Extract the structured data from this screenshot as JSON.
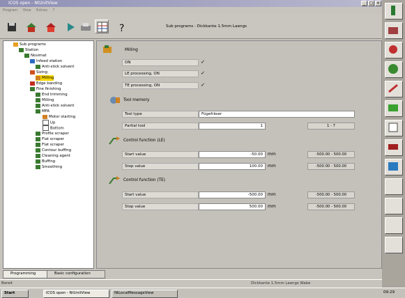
{
  "window": {
    "title": "ICOS open - NtUnitView"
  },
  "menu": [
    "Program",
    "View",
    "Extras",
    "?"
  ],
  "toolbar": {
    "subprogram_label": "Sub programs : Dickkante 1.5mm Laengs"
  },
  "tree": [
    {
      "label": "Sub programs"
    },
    {
      "label": "Station"
    },
    {
      "label": "Novimat"
    },
    {
      "label": "Infeed station"
    },
    {
      "label": "Anti-stick solvent"
    },
    {
      "label": "Sizing"
    },
    {
      "label": "Milling"
    },
    {
      "label": "Edge banding"
    },
    {
      "label": "Fine finishing"
    },
    {
      "label": "End trimming"
    },
    {
      "label": "Milling"
    },
    {
      "label": "Anti-stick solvent"
    },
    {
      "label": "MFA"
    },
    {
      "label": "Motor starting"
    },
    {
      "label": "Up"
    },
    {
      "label": "Bottom"
    },
    {
      "label": "Profile scraper"
    },
    {
      "label": "Flat scraper"
    },
    {
      "label": "Flat scraper"
    },
    {
      "label": "Contour buffing"
    },
    {
      "label": "Cleaning agent"
    },
    {
      "label": "Buffing"
    },
    {
      "label": "Smoothing"
    }
  ],
  "tabs": {
    "programming": "Programming",
    "basic": "Basic configuration"
  },
  "milling": {
    "title": "Milling",
    "rows": [
      {
        "label": "ON",
        "checked": "✓"
      },
      {
        "label": "LE processing, ON",
        "checked": "✓"
      },
      {
        "label": "TE processing, ON",
        "checked": "✓"
      }
    ]
  },
  "tool_memory": {
    "title": "Tool memory",
    "tool_type_label": "Tool type",
    "tool_type_value": "Fügefräser",
    "partial_tool_label": "Partial tool",
    "partial_tool_value": "1",
    "partial_tool_range": "1 - 7"
  },
  "control_le": {
    "title": "Control function (LE)",
    "start_label": "Start value",
    "start_value": "-50.00",
    "start_unit": "mm",
    "start_range": "-500.00 - 500.00",
    "stop_label": "Stop value",
    "stop_value": "100.00",
    "stop_unit": "mm",
    "stop_range": "-500.00 - 500.00"
  },
  "control_te": {
    "title": "Control function (TE)",
    "start_label": "Start value",
    "start_value": "-500.00",
    "start_unit": "mm",
    "start_range": "-500.00 - 500.00",
    "stop_label": "Stop value",
    "stop_value": "500.00",
    "stop_unit": "mm",
    "stop_range": "-500.00 - 500.00"
  },
  "status": {
    "left": "Bereit",
    "center": "Dickkante 1.5mm Laengs Wabe"
  },
  "taskbar": {
    "start": "Start",
    "task1": "ICOS open - NtUnitView",
    "task2": "NtLocalMessageView",
    "clock": "09:29"
  }
}
